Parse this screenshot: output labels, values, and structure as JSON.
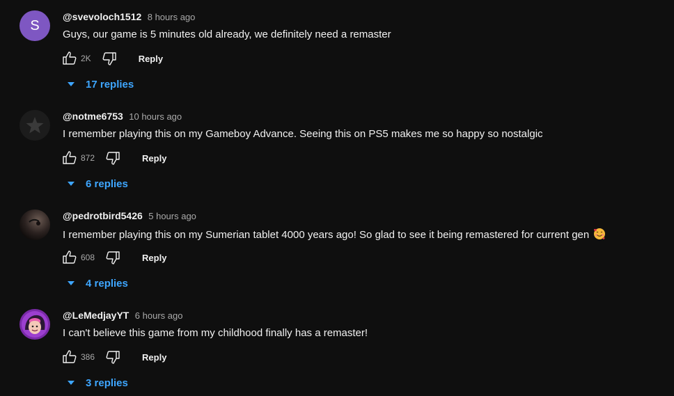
{
  "comments": [
    {
      "author": "@svevoloch1512",
      "time": "8 hours ago",
      "text": "Guys, our game is 5 minutes old already, we definitely need a remaster",
      "likes": "2K",
      "reply_label": "Reply",
      "replies_label": "17 replies",
      "avatar": {
        "type": "letter",
        "letter": "S",
        "color": "#7e57c2"
      }
    },
    {
      "author": "@notme6753",
      "time": "10 hours ago",
      "text": "I remember playing this on my Gameboy Advance. Seeing this on PS5 makes me so happy so nostalgic",
      "likes": "872",
      "reply_label": "Reply",
      "replies_label": "6 replies",
      "avatar": {
        "type": "image",
        "icon": "star-icon"
      }
    },
    {
      "author": "@pedrotbird5426",
      "time": "5 hours ago",
      "text": "I remember playing this on my Sumerian tablet 4000 years ago! So glad to see it being remastered for current gen",
      "emoji": "🥰",
      "likes": "608",
      "reply_label": "Reply",
      "replies_label": "4 replies",
      "avatar": {
        "type": "image",
        "icon": "photo-avatar"
      }
    },
    {
      "author": "@LeMedjayYT",
      "time": "6 hours ago",
      "text": "I can't believe this game from my childhood finally has a remaster!",
      "likes": "386",
      "reply_label": "Reply",
      "replies_label": "3 replies",
      "avatar": {
        "type": "image",
        "icon": "character-avatar"
      }
    }
  ],
  "colors": {
    "background": "#0f0f0f",
    "text": "#f1f1f1",
    "secondary": "#aaaaaa",
    "link": "#3ea6ff"
  }
}
